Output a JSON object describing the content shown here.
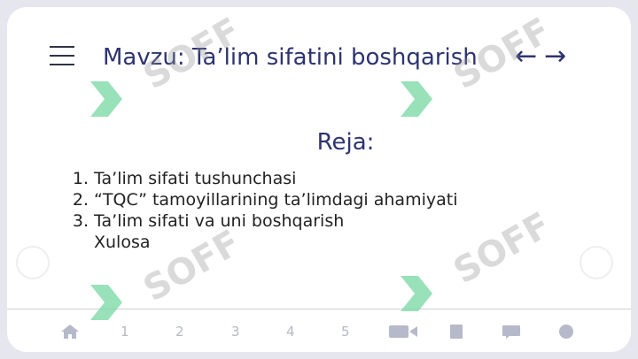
{
  "header": {
    "title": "Mavzu: Ta’lim sifatini boshqarish",
    "prev_arrow": "←",
    "next_arrow": "→"
  },
  "content": {
    "subtitle": "Reja:",
    "items": [
      {
        "num": "1.",
        "text": "Ta’lim sifati tushunchasi"
      },
      {
        "num": "2.",
        "text": "“TQC” tamoyillarining ta’limdagi ahamiyati"
      },
      {
        "num": "3.",
        "text": "Ta’lim sifati va uni boshqarish"
      }
    ],
    "extra": "Xulosa"
  },
  "bottom_nav": {
    "pages": [
      "1",
      "2",
      "3",
      "4",
      "5"
    ]
  },
  "watermark": {
    "text": "SOFF"
  },
  "colors": {
    "accent": "#2e3470",
    "watermark_green": "#7fd9a8"
  }
}
